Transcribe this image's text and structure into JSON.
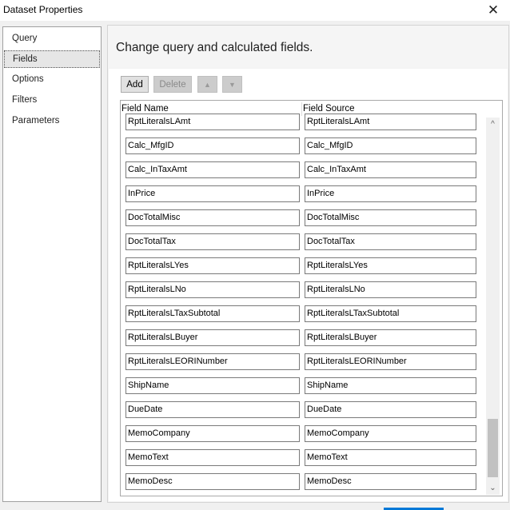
{
  "window": {
    "title": "Dataset Properties",
    "close_glyph": "✕"
  },
  "nav": {
    "items": [
      {
        "label": "Query",
        "selected": false
      },
      {
        "label": "Fields",
        "selected": true
      },
      {
        "label": "Options",
        "selected": false
      },
      {
        "label": "Filters",
        "selected": false
      },
      {
        "label": "Parameters",
        "selected": false
      }
    ]
  },
  "main": {
    "heading": "Change query and calculated fields.",
    "toolbar": {
      "add_label": "Add",
      "delete_label": "Delete",
      "move_up_icon": "arrow-up-icon",
      "move_down_icon": "arrow-down-icon"
    },
    "grid": {
      "columns": [
        "Field Name",
        "Field Source"
      ],
      "rows": [
        {
          "name": "RptLiteralsLAmt",
          "source": "RptLiteralsLAmt"
        },
        {
          "name": "Calc_MfgID",
          "source": "Calc_MfgID"
        },
        {
          "name": "Calc_InTaxAmt",
          "source": "Calc_InTaxAmt"
        },
        {
          "name": "InPrice",
          "source": "InPrice"
        },
        {
          "name": "DocTotalMisc",
          "source": "DocTotalMisc"
        },
        {
          "name": "DocTotalTax",
          "source": "DocTotalTax"
        },
        {
          "name": "RptLiteralsLYes",
          "source": "RptLiteralsLYes"
        },
        {
          "name": "RptLiteralsLNo",
          "source": "RptLiteralsLNo"
        },
        {
          "name": "RptLiteralsLTaxSubtotal",
          "source": "RptLiteralsLTaxSubtotal"
        },
        {
          "name": "RptLiteralsLBuyer",
          "source": "RptLiteralsLBuyer"
        },
        {
          "name": "RptLiteralsLEORINumber",
          "source": "RptLiteralsLEORINumber"
        },
        {
          "name": "ShipName",
          "source": "ShipName"
        },
        {
          "name": "DueDate",
          "source": "DueDate"
        },
        {
          "name": "MemoCompany",
          "source": "MemoCompany"
        },
        {
          "name": "MemoText",
          "source": "MemoText"
        },
        {
          "name": "MemoDesc",
          "source": "MemoDesc"
        }
      ]
    }
  },
  "colors": {
    "accent": "#0078d7",
    "border": "#7a7a7a"
  }
}
